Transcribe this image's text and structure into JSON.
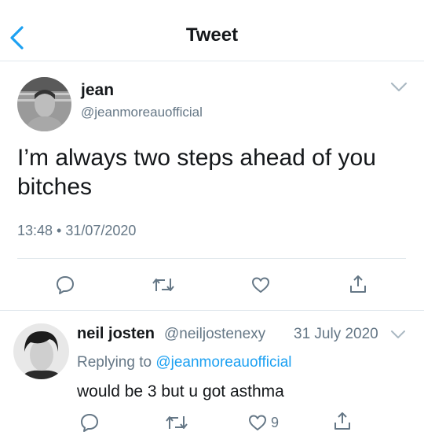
{
  "header": {
    "title": "Tweet",
    "back_icon": "chevron-left-icon"
  },
  "main_tweet": {
    "display_name": "jean",
    "handle": "@jeanmoreauofficial",
    "text": "I’m always two steps ahead of you bitches",
    "timestamp": "13:48 • 31/07/2020",
    "actions": {
      "reply": "reply-icon",
      "retweet": "retweet-icon",
      "like": "heart-icon",
      "share": "share-icon"
    }
  },
  "reply": {
    "display_name": "neil josten",
    "handle": "@neiljostenexy",
    "date": "31 July 2020",
    "replying_prefix": "Replying to",
    "replying_to": "@jeanmoreauofficial",
    "text": "would be 3 but u got asthma",
    "like_count": "9"
  },
  "colors": {
    "accent": "#1da1f2",
    "secondary_text": "#657786",
    "divider": "#e1e8ed"
  }
}
